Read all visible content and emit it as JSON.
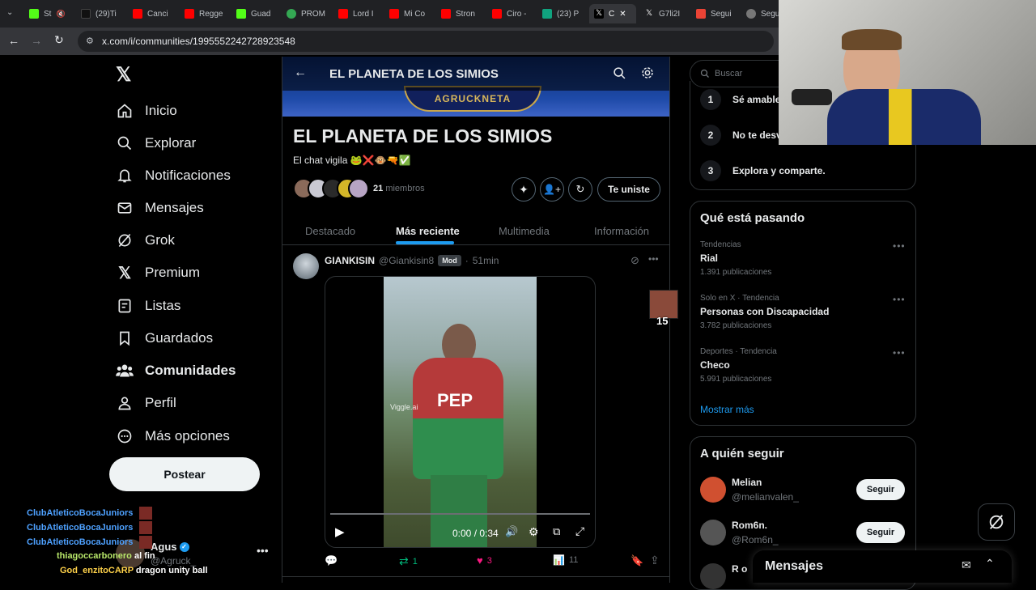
{
  "browser": {
    "tabs": [
      "St",
      "(29)Ti",
      "Canci",
      "Regge",
      "Guad",
      "PROM",
      "Lord I",
      "Mi Co",
      "Stron",
      "Ciro -",
      "(23) P",
      "C",
      "G7li2I",
      "Segui",
      "Segu"
    ],
    "url": "x.com/i/communities/1995552242728923548"
  },
  "nav": {
    "items": [
      "Inicio",
      "Explorar",
      "Notificaciones",
      "Mensajes",
      "Grok",
      "Premium",
      "Listas",
      "Guardados",
      "Comunidades",
      "Perfil",
      "Más opciones"
    ],
    "post_label": "Postear"
  },
  "account": {
    "name": "Agus",
    "handle": "@Agruck_"
  },
  "stream_chat": [
    {
      "user": "ClubAtleticoBocaJuniors",
      "msg": ""
    },
    {
      "user": "ClubAtleticoBocaJuniors",
      "msg": ""
    },
    {
      "user": "ClubAtleticoBocaJuniors",
      "msg": ""
    },
    {
      "user": "thiagoccarbonero",
      "msg": "al fin"
    },
    {
      "user": "God_enzitoCARP",
      "msg": "dragon unity ball"
    }
  ],
  "community": {
    "header_title": "EL PLANETA DE LOS SIMIOS",
    "banner_text": "AGRUCKNETA",
    "name": "EL PLANETA DE LOS SIMIOS",
    "description": "El chat vigila 🐸❌🐵🔫✅",
    "member_count": "21",
    "members_label": "miembros",
    "joined_label": "Te uniste",
    "tabs": [
      "Destacado",
      "Más reciente",
      "Multimedia",
      "Información"
    ],
    "active_tab": "Más reciente"
  },
  "post": {
    "author": "GIANKISIN",
    "handle": "@Giankisin8",
    "badge": "Mod",
    "time": "51min",
    "video_time": "0:00 / 0:34",
    "watermark": "Viggle.ai",
    "jersey_text": "PEP",
    "reposts": "1",
    "likes": "3",
    "views": "11"
  },
  "right": {
    "search_placeholder": "Buscar",
    "rules": [
      {
        "num": "1",
        "text": "Sé amable"
      },
      {
        "num": "2",
        "text": "No te desv"
      },
      {
        "num": "3",
        "text": "Explora y comparte."
      }
    ],
    "trending_title": "Qué está pasando",
    "trends": [
      {
        "meta": "Tendencias",
        "name": "Rial",
        "count": "1.391 publicaciones"
      },
      {
        "meta": "Solo en X · Tendencia",
        "name": "Personas con Discapacidad",
        "count": "3.782 publicaciones"
      },
      {
        "meta": "Deportes · Tendencia",
        "name": "Checo",
        "count": "5.991 publicaciones"
      }
    ],
    "show_more": "Mostrar más",
    "who_title": "A quién seguir",
    "follow": [
      {
        "name": "Melian",
        "handle": "@melianvalen_"
      },
      {
        "name": "Rom6n.",
        "handle": "@Rom6n_"
      },
      {
        "name": "R o",
        "handle": ""
      }
    ],
    "follow_label": "Seguir",
    "messages_label": "Mensajes"
  },
  "sticker_count": "15",
  "colors": {
    "accent": "#1d9bf0",
    "like": "#f91880",
    "repost": "#00ba7c",
    "chat_user": "#4ea1ff",
    "chat_user2": "#b8e86a",
    "chat_user3": "#ffd24a"
  }
}
